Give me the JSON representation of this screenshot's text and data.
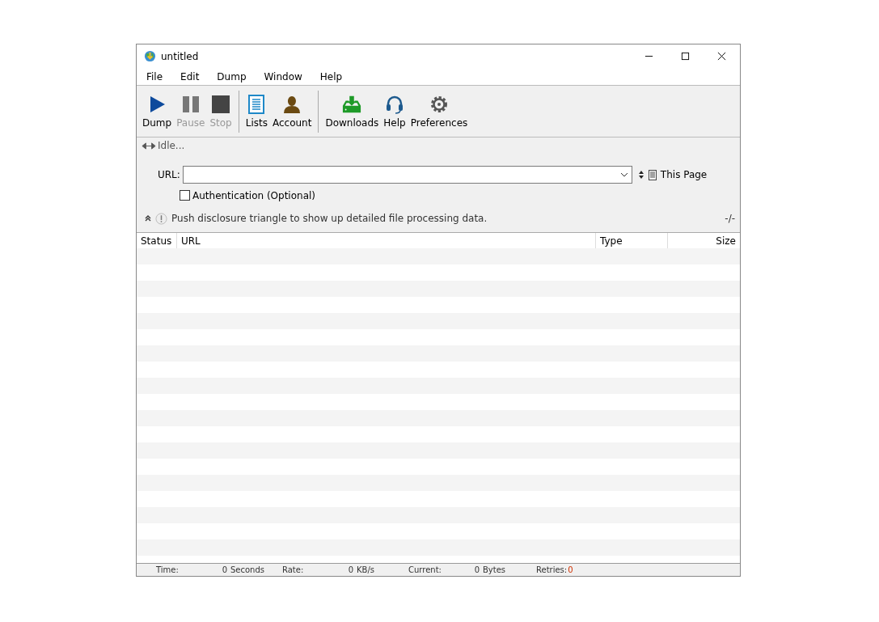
{
  "window": {
    "title": "untitled"
  },
  "menu": [
    "File",
    "Edit",
    "Dump",
    "Window",
    "Help"
  ],
  "toolbar": [
    [
      {
        "kind": "play",
        "label": "Dump",
        "disabled": false
      },
      {
        "kind": "pause",
        "label": "Pause",
        "disabled": true
      },
      {
        "kind": "stop",
        "label": "Stop",
        "disabled": true
      }
    ],
    [
      {
        "kind": "list",
        "label": "Lists",
        "disabled": false
      },
      {
        "kind": "person",
        "label": "Account",
        "disabled": false
      }
    ],
    [
      {
        "kind": "download",
        "label": "Downloads",
        "disabled": false
      },
      {
        "kind": "headset",
        "label": "Help",
        "disabled": false
      },
      {
        "kind": "gear",
        "label": "Preferences",
        "disabled": false
      }
    ]
  ],
  "activity": "Idle...",
  "url": {
    "label": "URL:",
    "scope": "This Page"
  },
  "authentication": {
    "label": "Authentication (Optional)",
    "checked": false
  },
  "hint": {
    "text": "Push disclosure triangle to show up detailed file processing data.",
    "counter": "-/-"
  },
  "table": {
    "columns": [
      "Status",
      "URL",
      "Type",
      "Size"
    ]
  },
  "status_bar": [
    {
      "label": "Time:",
      "value": "0",
      "unit": "Seconds"
    },
    {
      "label": "Rate:",
      "value": "0",
      "unit": "KB/s"
    },
    {
      "label": "Current:",
      "value": "0",
      "unit": "Bytes"
    }
  ],
  "retries": {
    "label": "Retries:",
    "value": "0"
  }
}
